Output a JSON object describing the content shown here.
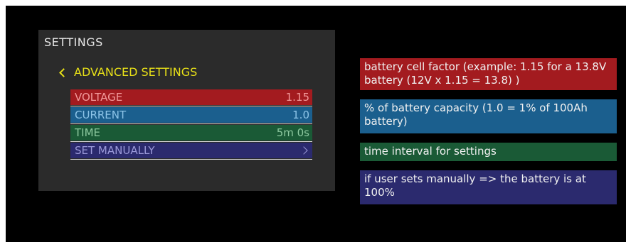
{
  "panel": {
    "title": "SETTINGS",
    "back_label": "ADVANCED SETTINGS",
    "rows": [
      {
        "label": "VOLTAGE",
        "value": "1.15"
      },
      {
        "label": "CURRENT",
        "value": "1.0"
      },
      {
        "label": "TIME",
        "value": "5m 0s"
      },
      {
        "label": "SET MANUALLY",
        "value": ""
      }
    ]
  },
  "notes": {
    "voltage": "battery cell factor (example: 1.15 for a 13.8V battery (12V x 1.15 = 13.8) )",
    "current": "% of battery capacity (1.0 = 1% of 100Ah battery)",
    "time": "time interval for settings",
    "manual": "if user sets manually => the battery is at 100%"
  },
  "colors": {
    "voltage": "#a31b1f",
    "current": "#1b5f8e",
    "time": "#1a5a36",
    "manual": "#2b2a6e",
    "back_accent": "#e8e018",
    "panel_bg": "#2b2b2b"
  },
  "icons": {
    "back": "chevron-left-icon",
    "manual": "chevron-right-icon"
  }
}
